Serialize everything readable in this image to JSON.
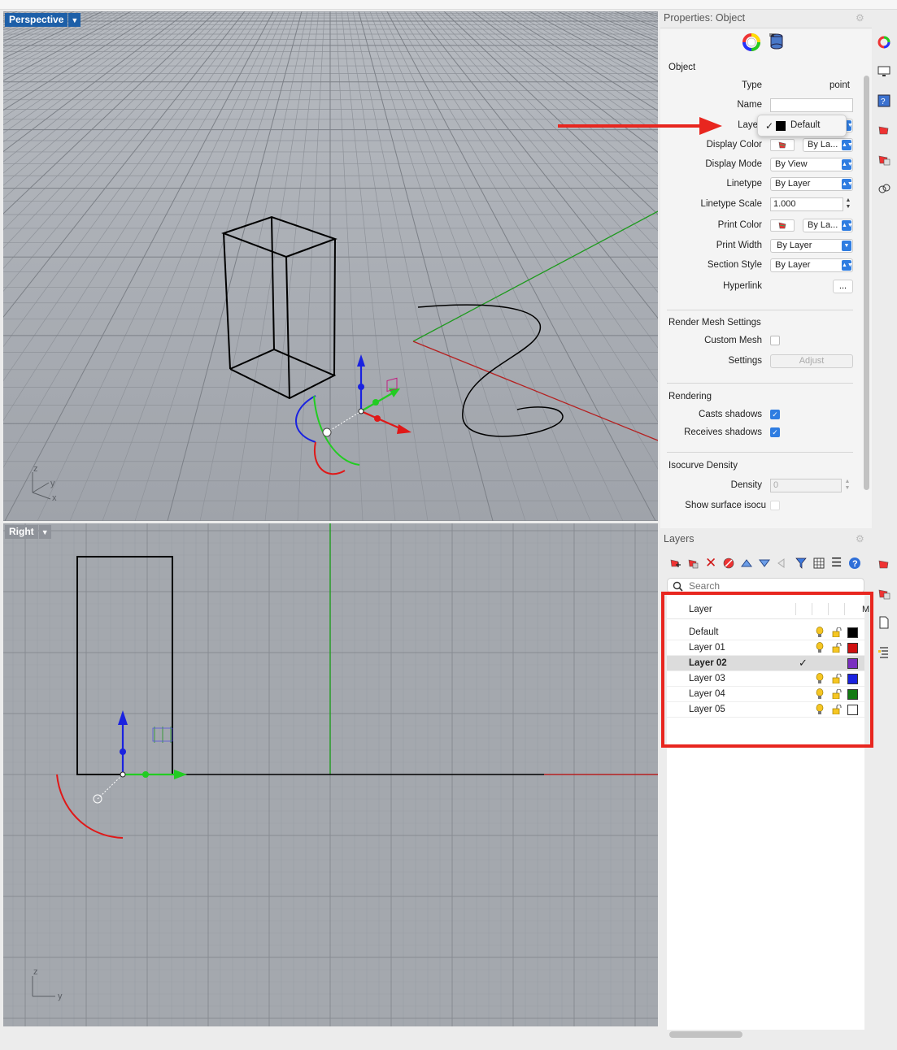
{
  "viewports": {
    "perspective": {
      "title": "Perspective",
      "axes": {
        "z": "z",
        "y": "y",
        "x": "x"
      }
    },
    "right": {
      "title": "Right",
      "axes": {
        "z": "z",
        "y": "y"
      }
    }
  },
  "properties": {
    "panel_title": "Properties: Object",
    "section_object": "Object",
    "type_label": "Type",
    "type_value": "point",
    "name_label": "Name",
    "name_value": "",
    "layer_label": "Laye",
    "layer_popup": {
      "check": "✓",
      "value": "Default",
      "swatch_color": "#000000"
    },
    "display_color_label": "Display Color",
    "display_color_value": "By La...",
    "display_mode_label": "Display Mode",
    "display_mode_value": "By View",
    "linetype_label": "Linetype",
    "linetype_value": "By Layer",
    "linetype_scale_label": "Linetype Scale",
    "linetype_scale_value": "1.000",
    "print_color_label": "Print Color",
    "print_color_value": "By La...",
    "print_width_label": "Print Width",
    "print_width_value": "By Layer",
    "section_style_label": "Section Style",
    "section_style_value": "By Layer",
    "hyperlink_label": "Hyperlink",
    "hyperlink_button": "...",
    "section_render_mesh": "Render Mesh Settings",
    "custom_mesh_label": "Custom Mesh",
    "settings_label": "Settings",
    "adjust_button": "Adjust",
    "section_rendering": "Rendering",
    "casts_shadows_label": "Casts shadows",
    "receives_shadows_label": "Receives shadows",
    "section_isocurve": "Isocurve Density",
    "density_label": "Density",
    "density_value": "0",
    "show_isocurves_label": "Show surface isocu"
  },
  "layers": {
    "panel_title": "Layers",
    "search_placeholder": "Search",
    "column_layer": "Layer",
    "column_m": "M",
    "rows": [
      {
        "name": "Default",
        "color": "#000000",
        "current": false
      },
      {
        "name": "Layer 01",
        "color": "#d01010",
        "current": false
      },
      {
        "name": "Layer 02",
        "color": "#7a2fc0",
        "current": true
      },
      {
        "name": "Layer 03",
        "color": "#1a22e0",
        "current": false
      },
      {
        "name": "Layer 04",
        "color": "#137a13",
        "current": false
      },
      {
        "name": "Layer 05",
        "color": "#ffffff",
        "current": false
      }
    ],
    "current_check": "✓"
  },
  "colors": {
    "accent": "#2f7de1",
    "annotation_red": "#e8261f",
    "viewport_active_tab": "#1d5fa8"
  },
  "icons": [
    "color-wheel-icon",
    "database-icon",
    "gear-icon",
    "new-layer-icon",
    "new-sublayer-icon",
    "delete-icon",
    "move-up-icon",
    "move-down-icon",
    "filter-icon",
    "table-icon",
    "list-icon",
    "help-icon",
    "search-icon",
    "bulb-icon",
    "lock-icon"
  ]
}
